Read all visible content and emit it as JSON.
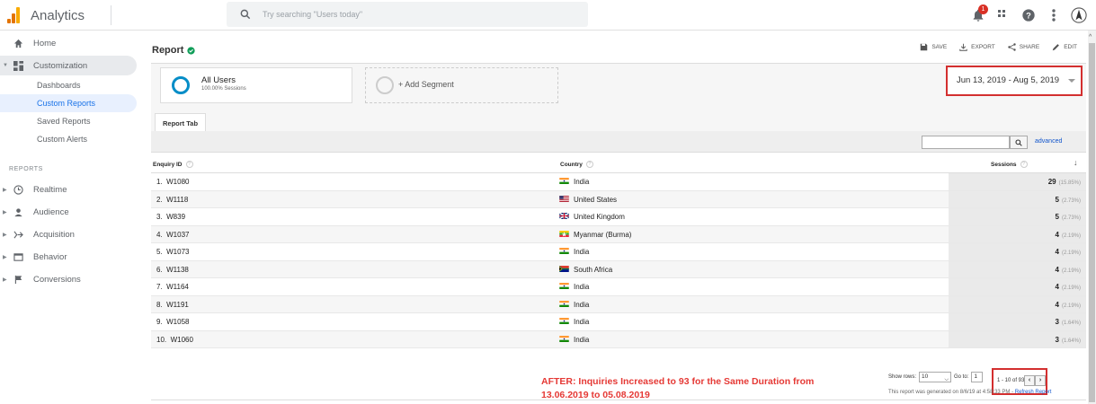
{
  "app": {
    "title": "Analytics",
    "search_placeholder": "Try searching \"Users today\"",
    "notification_count": "1"
  },
  "sidebar": {
    "home": "Home",
    "customization": "Customization",
    "sub_items": [
      "Dashboards",
      "Custom Reports",
      "Saved Reports",
      "Custom Alerts"
    ],
    "selected_sub": "Custom Reports",
    "reports_label": "REPORTS",
    "reports": [
      "Realtime",
      "Audience",
      "Acquisition",
      "Behavior",
      "Conversions"
    ]
  },
  "report": {
    "title": "Report",
    "actions": {
      "save": "SAVE",
      "export": "EXPORT",
      "share": "SHARE",
      "edit": "EDIT"
    },
    "segment": {
      "name": "All Users",
      "sub": "100.00% Sessions"
    },
    "add_segment": "+ Add Segment",
    "date_range": "Jun 13, 2019 - Aug 5, 2019",
    "tab": "Report Tab",
    "advanced": "advanced"
  },
  "table": {
    "headers": {
      "id": "Enquiry ID",
      "country": "Country",
      "sessions": "Sessions"
    },
    "rows": [
      {
        "num": "1.",
        "id": "W1080",
        "country": "India",
        "flag": "IN",
        "sessions": "29",
        "pct": "(15.85%)"
      },
      {
        "num": "2.",
        "id": "W1118",
        "country": "United States",
        "flag": "US",
        "sessions": "5",
        "pct": "(2.73%)"
      },
      {
        "num": "3.",
        "id": "W839",
        "country": "United Kingdom",
        "flag": "GB",
        "sessions": "5",
        "pct": "(2.73%)"
      },
      {
        "num": "4.",
        "id": "W1037",
        "country": "Myanmar (Burma)",
        "flag": "MM",
        "sessions": "4",
        "pct": "(2.19%)"
      },
      {
        "num": "5.",
        "id": "W1073",
        "country": "India",
        "flag": "IN",
        "sessions": "4",
        "pct": "(2.19%)"
      },
      {
        "num": "6.",
        "id": "W1138",
        "country": "South Africa",
        "flag": "ZA",
        "sessions": "4",
        "pct": "(2.19%)"
      },
      {
        "num": "7.",
        "id": "W1164",
        "country": "India",
        "flag": "IN",
        "sessions": "4",
        "pct": "(2.19%)"
      },
      {
        "num": "8.",
        "id": "W1191",
        "country": "India",
        "flag": "IN",
        "sessions": "4",
        "pct": "(2.19%)"
      },
      {
        "num": "9.",
        "id": "W1058",
        "country": "India",
        "flag": "IN",
        "sessions": "3",
        "pct": "(1.64%)"
      },
      {
        "num": "10.",
        "id": "W1060",
        "country": "India",
        "flag": "IN",
        "sessions": "3",
        "pct": "(1.64%)"
      }
    ]
  },
  "footer": {
    "note_line1": "AFTER: Inquiries Increased to 93 for the Same Duration from",
    "note_line2": "13.06.2019 to 05.08.2019",
    "show_rows_label": "Show rows:",
    "show_rows_value": "10",
    "goto_label": "Go to:",
    "goto_value": "1",
    "range": "1 - 10 of 93",
    "prev": "‹",
    "next": "›",
    "generated": "This report was generated on 8/6/19 at 4:58:33 PM - ",
    "refresh": "Refresh Report"
  },
  "colors": {
    "accent": "#1a73e8",
    "highlight_red": "#d32f2f",
    "note_red": "#e53935",
    "segment_blue": "#058dc7"
  }
}
